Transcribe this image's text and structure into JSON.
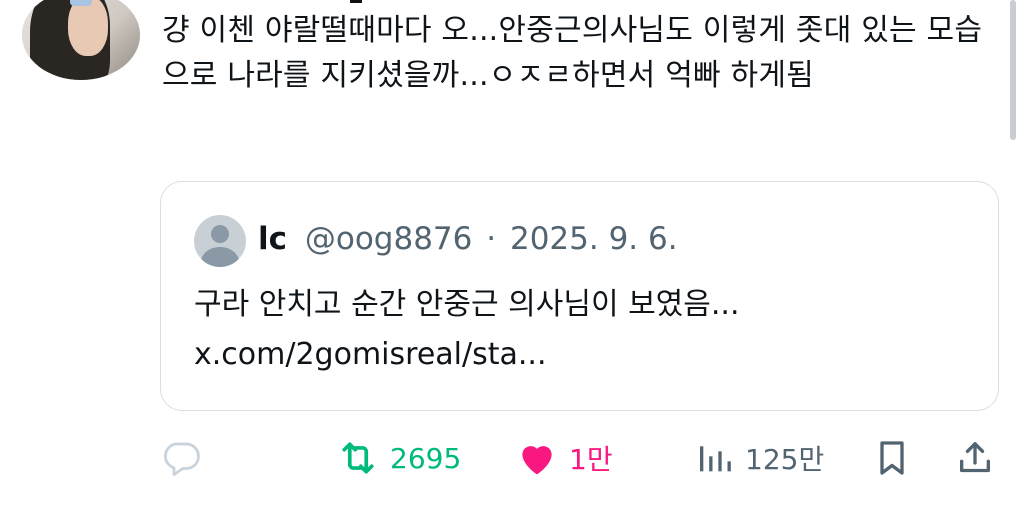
{
  "post": {
    "text": "걍 이첸 야랄떨때마다 오...안중근의사님도 이렇게 좃대 있는 모습으로 나라를 지키셨을까...ㅇㅈㄹ하면서 억빠 하게됨"
  },
  "quote": {
    "name": "lc",
    "handle": "@oog8876",
    "separator": "·",
    "date": "2025. 9. 6.",
    "text": "구라 안치고 순간 안중근 의사님이 보였음...",
    "link": "x.com/2gomisreal/sta..."
  },
  "actions": {
    "reply_icon": "reply-icon",
    "retweet_count": "2695",
    "like_count": "1만",
    "views_count": "125만"
  },
  "colors": {
    "retweet": "#00ba7c",
    "like": "#f91880",
    "muted": "#536471"
  }
}
